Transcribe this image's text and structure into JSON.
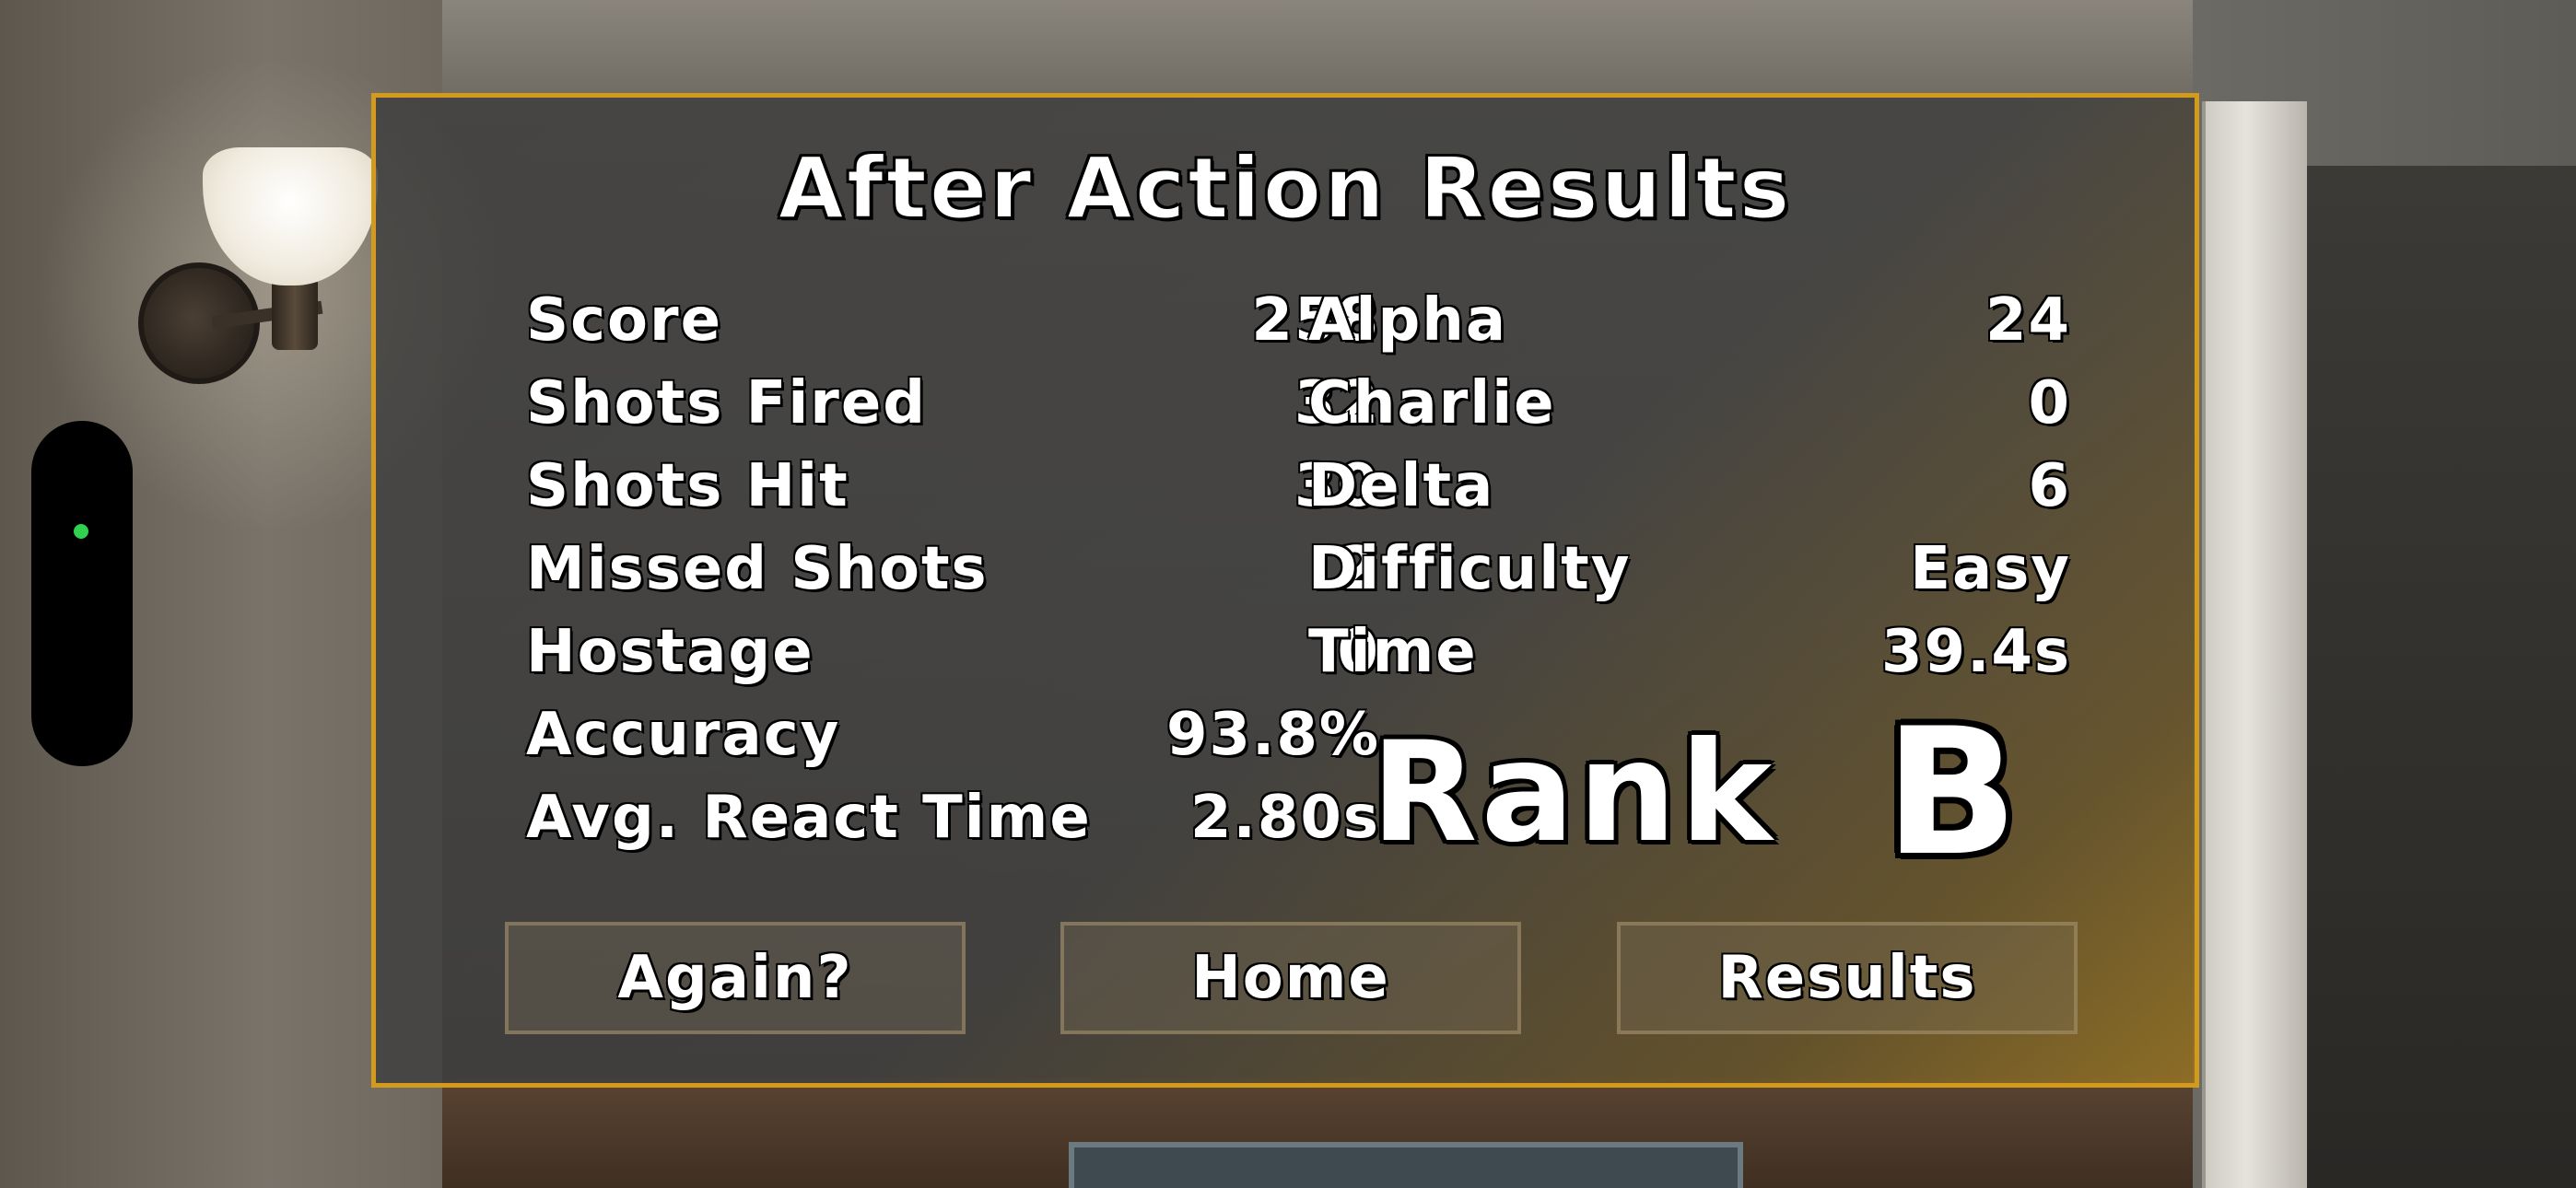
{
  "title": "After Action Results",
  "stats_left": [
    {
      "label": "Score",
      "value": "258"
    },
    {
      "label": "Shots Fired",
      "value": "32"
    },
    {
      "label": "Shots Hit",
      "value": "30"
    },
    {
      "label": "Missed Shots",
      "value": "2"
    },
    {
      "label": "Hostage",
      "value": "0"
    },
    {
      "label": "Accuracy",
      "value": "93.8%"
    },
    {
      "label": "Avg. React Time",
      "value": "2.80s"
    }
  ],
  "stats_right": [
    {
      "label": "Alpha",
      "value": "24"
    },
    {
      "label": "Charlie",
      "value": "0"
    },
    {
      "label": "Delta",
      "value": "6"
    },
    {
      "label": "Difficulty",
      "value": "Easy"
    },
    {
      "label": "Time",
      "value": "39.4s"
    }
  ],
  "rank": {
    "label": "Rank",
    "grade": "B"
  },
  "buttons": {
    "again": "Again?",
    "home": "Home",
    "results": "Results"
  },
  "colors": {
    "panel_border": "#d39a1c",
    "indicator_dot": "#2fd14f"
  },
  "icons": {
    "indicator": "status-dot-icon",
    "lamp": "wall-lamp"
  }
}
